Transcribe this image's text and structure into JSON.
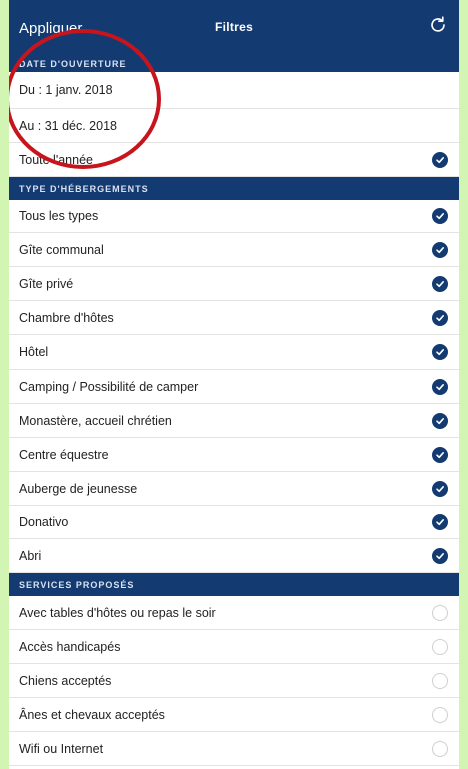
{
  "header": {
    "apply_label": "Appliquer",
    "title": "Filtres",
    "refresh_icon": "refresh-icon"
  },
  "sections": [
    {
      "title": "DATE D'OUVERTURE",
      "items": [
        {
          "label": "Du : 1 janv. 2018",
          "checked": null
        },
        {
          "label": "Au : 31 déc. 2018",
          "checked": null
        },
        {
          "label": "Toute l'année",
          "checked": true
        }
      ]
    },
    {
      "title": "TYPE D'HÉBERGEMENTS",
      "items": [
        {
          "label": "Tous les types",
          "checked": true
        },
        {
          "label": "Gîte communal",
          "checked": true
        },
        {
          "label": "Gîte privé",
          "checked": true
        },
        {
          "label": "Chambre d'hôtes",
          "checked": true
        },
        {
          "label": "Hôtel",
          "checked": true
        },
        {
          "label": "Camping / Possibilité de camper",
          "checked": true
        },
        {
          "label": "Monastère, accueil chrétien",
          "checked": true
        },
        {
          "label": "Centre équestre",
          "checked": true
        },
        {
          "label": "Auberge de jeunesse",
          "checked": true
        },
        {
          "label": "Donativo",
          "checked": true
        },
        {
          "label": "Abri",
          "checked": true
        }
      ]
    },
    {
      "title": "SERVICES PROPOSÉS",
      "items": [
        {
          "label": "Avec tables d'hôtes ou repas le soir",
          "checked": false
        },
        {
          "label": "Accès handicapés",
          "checked": false
        },
        {
          "label": "Chiens acceptés",
          "checked": false
        },
        {
          "label": "Ânes et chevaux acceptés",
          "checked": false
        },
        {
          "label": "Wifi ou Internet",
          "checked": false
        }
      ]
    }
  ],
  "colors": {
    "accent": "#143a72",
    "annotation": "#c8141c",
    "background": "#d3f5b3"
  }
}
